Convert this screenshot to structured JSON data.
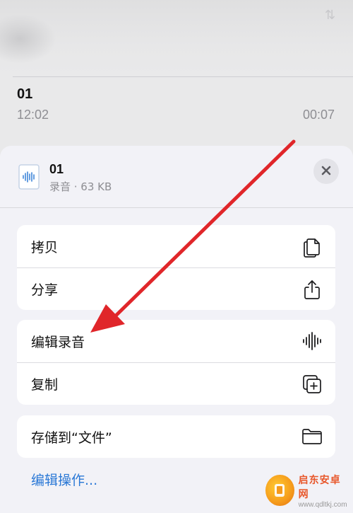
{
  "background": {
    "recording_title": "01",
    "recording_time": "12:02",
    "recording_duration": "00:07"
  },
  "sheet": {
    "file_name": "01",
    "file_meta": "录音 · 63 KB",
    "close_icon": "close-icon",
    "groups": [
      {
        "items": [
          {
            "label": "拷贝",
            "icon": "copy-icon"
          },
          {
            "label": "分享",
            "icon": "share-icon"
          }
        ]
      },
      {
        "items": [
          {
            "label": "编辑录音",
            "icon": "waveform-icon"
          },
          {
            "label": "复制",
            "icon": "duplicate-icon"
          }
        ]
      },
      {
        "items": [
          {
            "label": "存储到“文件”",
            "icon": "folder-icon"
          }
        ]
      }
    ],
    "edit_actions": "编辑操作..."
  },
  "watermark": {
    "name": "启东安卓网",
    "url": "www.qdltkj.com"
  },
  "colors": {
    "accent": "#2a78d6",
    "annotation_arrow": "#e0262a"
  }
}
